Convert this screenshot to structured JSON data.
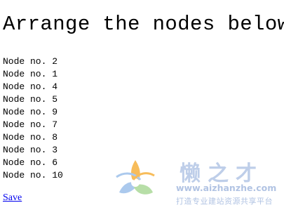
{
  "page": {
    "heading": "Arrange the nodes below"
  },
  "nodes": [
    {
      "label": "Node no. 2"
    },
    {
      "label": "Node no. 1"
    },
    {
      "label": "Node no. 4"
    },
    {
      "label": "Node no. 5"
    },
    {
      "label": "Node no. 9"
    },
    {
      "label": "Node no. 7"
    },
    {
      "label": "Node no. 8"
    },
    {
      "label": "Node no. 3"
    },
    {
      "label": "Node no. 6"
    },
    {
      "label": "Node no. 10"
    }
  ],
  "actions": {
    "save_label": "Save"
  },
  "watermark": {
    "title": "懒之才",
    "url": "www.aizhanzhe.com",
    "slogan": "打造专业建站资源共享平台",
    "colors": {
      "text": "#a9bde0",
      "logo_orange": "#f5a623",
      "logo_blue": "#8fb8e8",
      "logo_green": "#9fd48a"
    }
  }
}
